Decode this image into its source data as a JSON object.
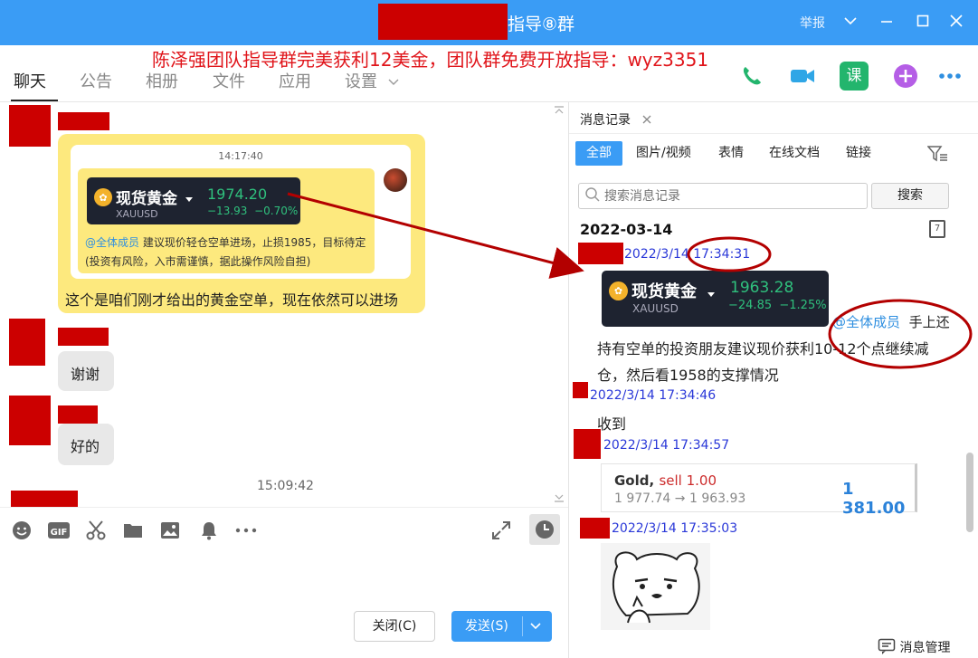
{
  "window": {
    "title": "指导⑧群",
    "report_label": "举报"
  },
  "banner": {
    "text": "陈泽强团队指导群完美获利12美金，团队群免费开放指导：wyz3351"
  },
  "tabs": [
    {
      "label": "聊天"
    },
    {
      "label": "公告"
    },
    {
      "label": "相册"
    },
    {
      "label": "文件"
    },
    {
      "label": "应用"
    },
    {
      "label": "设置"
    }
  ],
  "chat": {
    "card": {
      "time": "14:17:40",
      "quote": {
        "name": "现货黄金",
        "symbol": "XAUUSD",
        "price": "1974.20",
        "change": "−13.93",
        "change_pct": "−0.70%"
      },
      "mention": "@全体成员",
      "line1": "建议现价轻仓空单进场，止损1985，目标待定",
      "line2": "(投资有风险，入市需谨慎，据此操作风险自担)"
    },
    "yellow_caption": "这个是咱们刚才给出的黄金空单，现在依然可以进场",
    "msg_thanks": "谢谢",
    "msg_ok": "好的",
    "center_time": "15:09:42"
  },
  "composer": {
    "close_label": "关闭(C)",
    "send_label": "发送(S)"
  },
  "history": {
    "tab_title": "消息记录",
    "filters": [
      "全部",
      "图片/视频",
      "表情",
      "在线文档",
      "链接"
    ],
    "search_placeholder": "搜索消息记录",
    "search_button": "搜索",
    "date_heading": "2022-03-14",
    "calendar_day": "7",
    "messages": [
      {
        "time": "2022/3/14 17:34:31"
      },
      {
        "time": "2022/3/14 17:34:46",
        "text": "收到"
      },
      {
        "time": "2022/3/14 17:34:57"
      },
      {
        "time": "2022/3/14 17:35:03"
      }
    ],
    "quote": {
      "name": "现货黄金",
      "symbol": "XAUUSD",
      "price": "1963.28",
      "change": "−24.85",
      "change_pct": "−1.25%"
    },
    "mention": "@全体成员",
    "text_tail": "手上还",
    "text_line2": "持有空单的投资朋友建议现价获利10-12个点继续减",
    "text_line3": "仓，然后看1958的支撑情况",
    "trade": {
      "instrument": "Gold,",
      "side": "sell 1.00",
      "prices": "1 977.74 → 1 963.93",
      "profit": "1 381.00"
    },
    "footer": "消息管理"
  },
  "colors": {
    "title_bar": "#3a9cf5",
    "redaction": "#cc0000",
    "annotation": "#b30000",
    "banner_text": "#e0141a",
    "up_green": "#2fc07d",
    "profit_blue": "#2b82d9",
    "time_blue": "#2a38d8"
  }
}
